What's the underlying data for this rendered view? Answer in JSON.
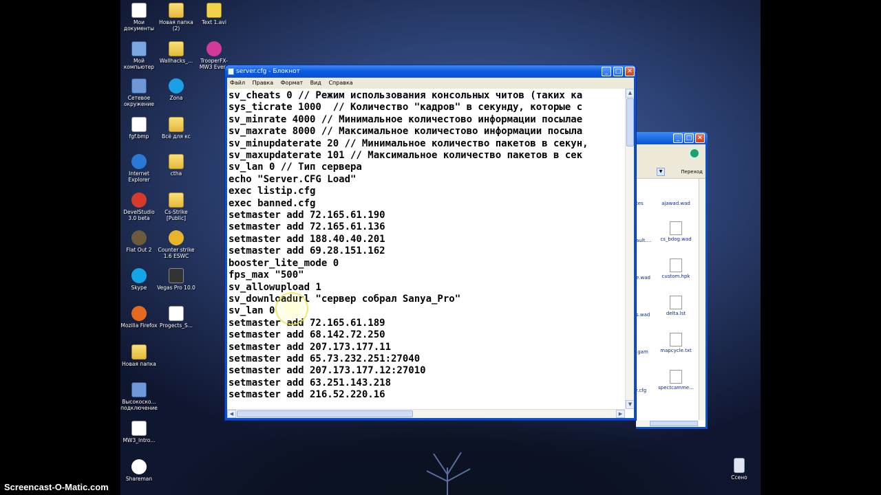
{
  "desktop_icons": [
    {
      "label": "Мои документы"
    },
    {
      "label": "Новая папка (2)"
    },
    {
      "label": "Text 1.avi"
    },
    {
      "label": "Мой компьютер"
    },
    {
      "label": "Wallhacks_..."
    },
    {
      "label": "TrooperFX-MW3 Every"
    },
    {
      "label": "Сетевое окружение"
    },
    {
      "label": "Zona"
    },
    {
      "label": "fgf.bmp"
    },
    {
      "label": "Всё для кс"
    },
    {
      "label": "Internet Explorer"
    },
    {
      "label": "ctha"
    },
    {
      "label": "DevelStudio 3.0 beta"
    },
    {
      "label": "Cs-Strike [Public]"
    },
    {
      "label": "Flat Out 2"
    },
    {
      "label": "Counter strike 1.6 ESWC"
    },
    {
      "label": "Skype"
    },
    {
      "label": "Vegas Pro 10.0"
    },
    {
      "label": "Mozilla Firefox"
    },
    {
      "label": "Progects_S..."
    },
    {
      "label": "Новая папка"
    },
    {
      "label": "Высокоско... подключение"
    },
    {
      "label": "MW3_Intro..."
    },
    {
      "label": "Shareman"
    },
    {
      "label": "Ссено"
    }
  ],
  "notepad": {
    "title": "server.cfg - Блокнот",
    "menu": [
      "Файл",
      "Правка",
      "Формат",
      "Вид",
      "Справка"
    ],
    "lines": [
      "sv_cheats 0 // Режим использования консольных читов (таких ка",
      "sys_ticrate 1000  // Количество \"кадров\" в секунду, которые с",
      "sv_minrate 4000 // Минимальное количестово информации посылае",
      "sv_maxrate 8000 // Максимальное количестово информации посыла",
      "sv_minupdaterate 20 // Минимальное количество пакетов в секун,",
      "sv_maxupdaterate 101 // Максимальное количество пакетов в сек",
      "sv_lan 0 // Тип сервера",
      "echo \"Server.CFG Load\"",
      "exec listip.cfg",
      "exec banned.cfg",
      "setmaster add 72.165.61.190",
      "setmaster add 72.165.61.136",
      "setmaster add 188.40.40.201",
      "setmaster add 69.28.151.162",
      "booster_lite_mode 0",
      "fps_max \"500\"",
      "sv_allowupload 1",
      "sv_downloadurl \"сервер собрал Sanya_Pro\"",
      "sv_lan 0",
      "setmaster add 72.165.61.189",
      "setmaster add 68.142.72.250",
      "setmaster add 207.173.177.11",
      "setmaster add 65.73.232.251:27040",
      "setmaster add 207.173.177.12:27010",
      "setmaster add 63.251.143.218",
      "setmaster add 216.52.220.16"
    ]
  },
  "explorer": {
    "go_label": "Переход",
    "side_items": [
      "tes",
      "ault....",
      "e.wad",
      "s.wad",
      ".gam",
      "r.cfg"
    ],
    "files": [
      "ajawad.wad",
      "cs_bdog.wad",
      "custom.hpk",
      "delta.lst",
      "mapcycle.txt",
      "spectcamme..."
    ]
  },
  "watermark": "Screencast-O-Matic.com"
}
